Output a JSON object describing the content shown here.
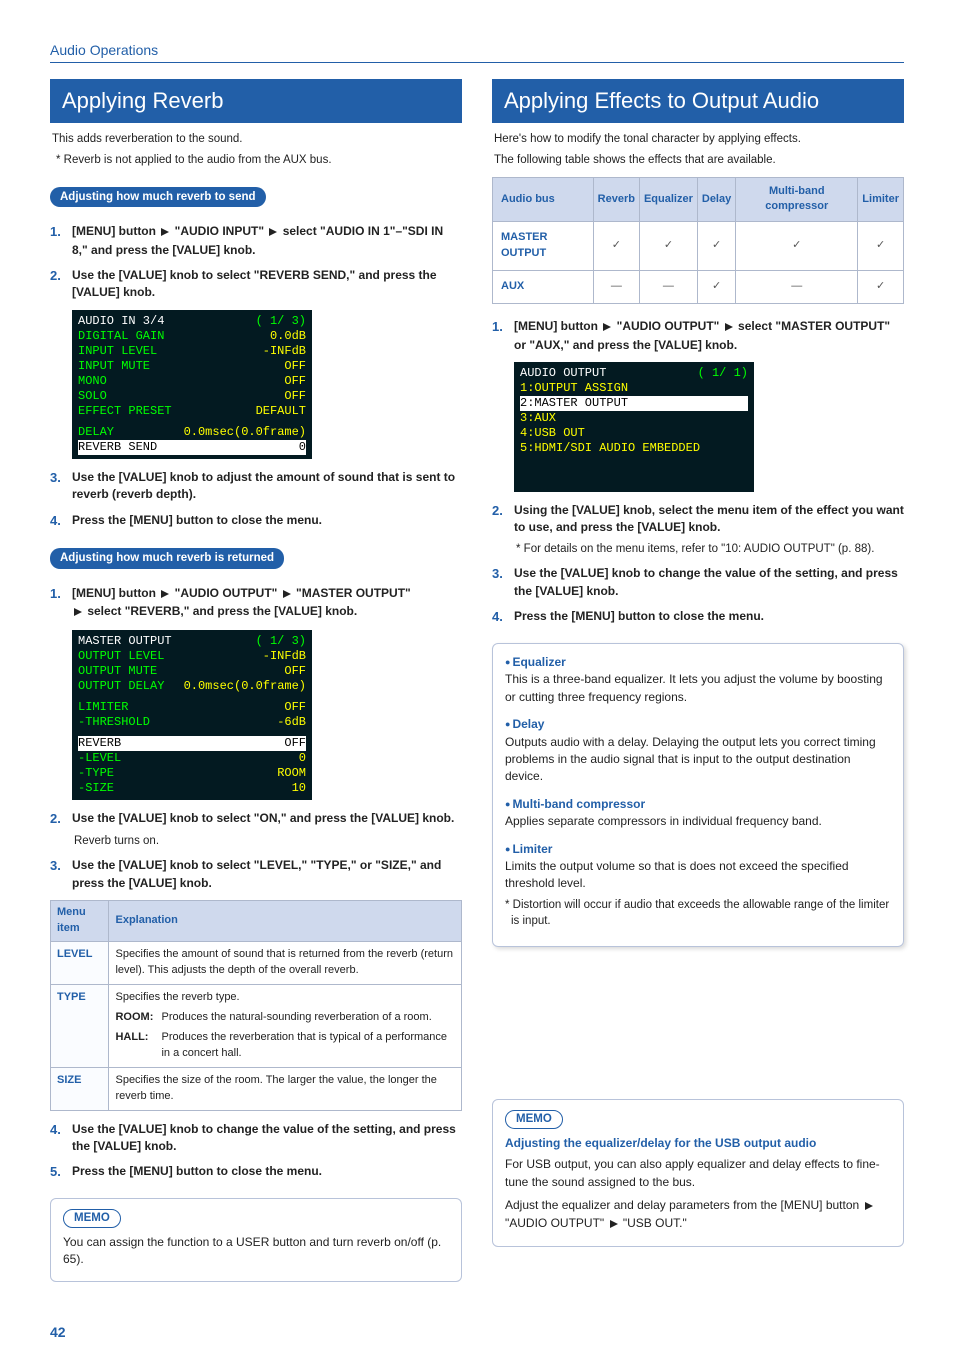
{
  "page_number": "42",
  "section_header": "Audio Operations",
  "left": {
    "title": "Applying Reverb",
    "intro": "This adds reverberation to the sound.",
    "note": "* Reverb is not applied to the audio from the AUX bus.",
    "adj_send_pill": "Adjusting how much reverb to send",
    "s1_a": "[MENU] button ",
    "s1_b": " \"AUDIO INPUT\" ",
    "s1_c": " select \"AUDIO IN 1\"–\"SDI IN 8,\" and press the [VALUE] knob.",
    "s2": "Use the [VALUE] knob to select \"REVERB SEND,\" and press the [VALUE] knob.",
    "mon_send": {
      "title_l": "AUDIO IN 3/4",
      "title_r": "( 1/ 3)",
      "r1l": "DIGITAL GAIN",
      "r1r": "0.0dB",
      "r2l": "INPUT LEVEL",
      "r2r": "-INFdB",
      "r3l": "INPUT MUTE",
      "r3r": "OFF",
      "r4l": "MONO",
      "r4r": "OFF",
      "r5l": "SOLO",
      "r5r": "OFF",
      "r6l": "EFFECT PRESET",
      "r6r": "DEFAULT",
      "r7l": "DELAY",
      "r7r": "0.0msec(0.0frame)",
      "hl_l": "REVERB SEND",
      "hl_r": "0"
    },
    "s3": "Use the [VALUE] knob to adjust the amount of sound that is sent to reverb (reverb depth).",
    "s4": "Press the [MENU] button to close the menu.",
    "adj_ret_pill": "Adjusting how much reverb is returned",
    "r_s1_a": "[MENU] button ",
    "r_s1_b": " \"AUDIO OUTPUT\" ",
    "r_s1_c": " \"MASTER OUTPUT\" ",
    "r_s1_d": " select \"REVERB,\" and press the [VALUE] knob.",
    "mon_ret": {
      "title_l": "MASTER OUTPUT",
      "title_r": "( 1/ 3)",
      "r1l": "OUTPUT LEVEL",
      "r1r": "-INFdB",
      "r2l": "OUTPUT MUTE",
      "r2r": "OFF",
      "r3l": "OUTPUT DELAY",
      "r3r": "0.0msec(0.0frame)",
      "r4l": "LIMITER",
      "r4r": "OFF",
      "r5l": " -THRESHOLD",
      "r5r": "-6dB",
      "hl_l": "REVERB",
      "hl_r": "OFF",
      "r6l": " -LEVEL",
      "r6r": "0",
      "r7l": " -TYPE",
      "r7r": "ROOM",
      "r8l": " -SIZE",
      "r8r": "10"
    },
    "r_s2": "Use the [VALUE] knob to select \"ON,\" and press the [VALUE] knob.",
    "r_s2_sub": "Reverb turns on.",
    "r_s3": "Use the [VALUE] knob to select \"LEVEL,\" \"TYPE,\" or \"SIZE,\" and press the [VALUE] knob.",
    "spec_h1": "Menu item",
    "spec_h2": "Explanation",
    "level_name": "LEVEL",
    "level_desc": "Specifies the amount of sound that is returned from the reverb (return level). This adjusts the depth of the overall reverb.",
    "type_name": "TYPE",
    "type_intro": "Specifies the reverb type.",
    "room_lbl": "ROOM:",
    "room_desc": "Produces the natural-sounding reverberation of a room.",
    "hall_lbl": "HALL:",
    "hall_desc": "Produces the reverberation that is typical of a performance in a concert hall.",
    "size_name": "SIZE",
    "size_desc": "Specifies the size of the room. The larger the value, the longer the reverb time.",
    "r_s4": "Use the [VALUE] knob to change the value of the setting, and press the [VALUE] knob.",
    "r_s5": "Press the [MENU] button to close the menu.",
    "memo_label": "MEMO",
    "memo_text": "You can assign the function to a USER button and turn reverb on/off (p. 65)."
  },
  "right": {
    "title": "Applying Effects to Output Audio",
    "intro1": "Here's how to modify the tonal character by applying effects.",
    "intro2": "The following table shows the effects that are available.",
    "fx_h": [
      "Audio bus",
      "Reverb",
      "Equalizer",
      "Delay",
      "Multi-band compressor",
      "Limiter"
    ],
    "row_master": "MASTER OUTPUT",
    "row_aux": "AUX",
    "check": "✓",
    "dash": "—",
    "s1_a": "[MENU] button ",
    "s1_b": " \"AUDIO OUTPUT\" ",
    "s1_c": " select \"MASTER OUTPUT\" or \"AUX,\" and press the [VALUE] knob.",
    "mon": {
      "title_l": "AUDIO OUTPUT",
      "title_r": "( 1/ 1)",
      "r1": " 1:OUTPUT ASSIGN",
      "r2": " 2:MASTER OUTPUT",
      "r3": " 3:AUX",
      "r4": " 4:USB OUT",
      "r5": " 5:HDMI/SDI AUDIO EMBEDDED"
    },
    "s2": "Using the [VALUE] knob, select the menu item of the effect you want to use, and press the [VALUE] knob.",
    "s2_note": "*  For details on the menu items, refer to \"10: AUDIO OUTPUT\" (p. 88).",
    "s3": "Use the [VALUE] knob to change the value of the setting, and press the [VALUE] knob.",
    "s4": "Press the [MENU] button to close the menu.",
    "eq_name": "Equalizer",
    "eq_desc": "This is a three-band equalizer. It lets you adjust the volume by boosting or cutting three frequency regions.",
    "dl_name": "Delay",
    "dl_desc": "Outputs audio with a delay. Delaying the output lets you correct timing problems in the audio signal that is input to the output destination device.",
    "mb_name": "Multi-band compressor",
    "mb_desc": "Applies separate compressors in individual frequency band.",
    "lm_name": "Limiter",
    "lm_desc": "Limits the output volume so that is does not exceed the specified threshold level.",
    "lm_note": "* Distortion will occur if audio that exceeds the allowable range of the limiter is input.",
    "memo_label": "MEMO",
    "memo_title": "Adjusting the equalizer/delay for the USB output audio",
    "memo_p1": "For USB output, you can also apply equalizer and delay effects to fine-tune the sound assigned to the bus.",
    "memo_p2a": "Adjust the equalizer and delay parameters from the [MENU] button ",
    "memo_p2b": " \"AUDIO OUTPUT\" ",
    "memo_p2c": " \"USB OUT.\""
  }
}
